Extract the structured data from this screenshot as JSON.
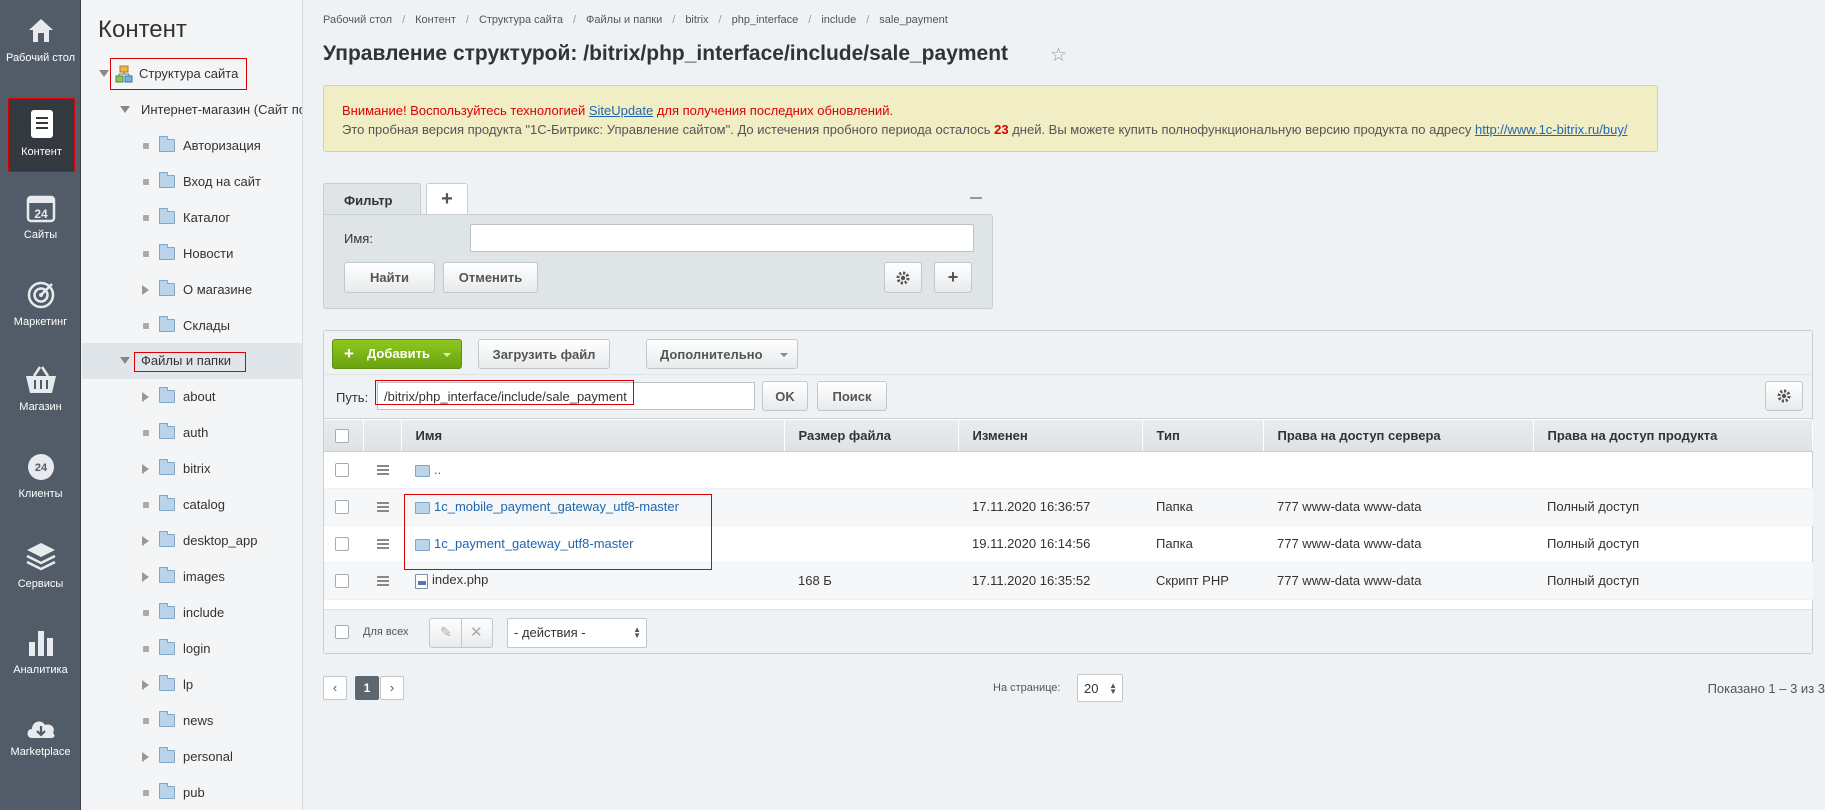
{
  "nav": [
    {
      "label": "Рабочий стол",
      "icon": "home-icon"
    },
    {
      "label": "Контент",
      "icon": "document-icon"
    },
    {
      "label": "Сайты",
      "icon": "calendar-24-icon"
    },
    {
      "label": "Маркетинг",
      "icon": "target-icon"
    },
    {
      "label": "Магазин",
      "icon": "basket-icon"
    },
    {
      "label": "Клиенты",
      "icon": "clients-24-icon"
    },
    {
      "label": "Сервисы",
      "icon": "layers-icon"
    },
    {
      "label": "Аналитика",
      "icon": "bar-chart-icon"
    },
    {
      "label": "Marketplace",
      "icon": "cloud-download-icon"
    }
  ],
  "tree": {
    "title": "Контент",
    "root": "Структура сайта",
    "shop": "Интернет-магазин (Сайт по",
    "shop_items": [
      {
        "label": "Авторизация",
        "expandable": false
      },
      {
        "label": "Вход на сайт",
        "expandable": false
      },
      {
        "label": "Каталог",
        "expandable": false
      },
      {
        "label": "Новости",
        "expandable": false
      },
      {
        "label": "О магазине",
        "expandable": true
      },
      {
        "label": "Склады",
        "expandable": false
      }
    ],
    "files": "Файлы и папки",
    "file_items": [
      {
        "label": "about",
        "expandable": true
      },
      {
        "label": "auth",
        "expandable": false
      },
      {
        "label": "bitrix",
        "expandable": true
      },
      {
        "label": "catalog",
        "expandable": false
      },
      {
        "label": "desktop_app",
        "expandable": true
      },
      {
        "label": "images",
        "expandable": true
      },
      {
        "label": "include",
        "expandable": false
      },
      {
        "label": "login",
        "expandable": false
      },
      {
        "label": "lp",
        "expandable": true
      },
      {
        "label": "news",
        "expandable": false
      },
      {
        "label": "personal",
        "expandable": true
      },
      {
        "label": "pub",
        "expandable": false
      }
    ]
  },
  "breadcrumb": [
    "Рабочий стол",
    "Контент",
    "Структура сайта",
    "Файлы и папки",
    "bitrix",
    "php_interface",
    "include",
    "sale_payment"
  ],
  "page_title": "Управление структурой: /bitrix/php_interface/include/sale_payment",
  "notice": {
    "line1_a": "Внимание! Воспользуйтесь технологией ",
    "line1_link": "SiteUpdate",
    "line1_b": " для получения последних обновлений.",
    "line2_a": "Это пробная версия продукта \"1С-Битрикс: Управление сайтом\". До истечения пробного периода осталось ",
    "days": "23",
    "line2_b": " дней. Вы можете купить полнофункциональную версию продукта по адресу ",
    "line2_link": "http://www.1c-bitrix.ru/buy/"
  },
  "filter": {
    "tab": "Фильтр",
    "add_tab": "+",
    "name_label": "Имя:",
    "name_value": "",
    "find": "Найти",
    "cancel": "Отменить"
  },
  "toolbar": {
    "add": "Добавить",
    "upload": "Загрузить файл",
    "more": "Дополнительно"
  },
  "path": {
    "label": "Путь:",
    "value": "/bitrix/php_interface/include/sale_payment",
    "ok": "OK",
    "search": "Поиск"
  },
  "table": {
    "columns": [
      "Имя",
      "Размер файла",
      "Изменен",
      "Тип",
      "Права на доступ сервера",
      "Права на доступ продукта"
    ],
    "rows": [
      {
        "name": "..",
        "kind": "up",
        "size": "",
        "modified": "",
        "type": "",
        "server": "",
        "product": ""
      },
      {
        "name": "1c_mobile_payment_gateway_utf8-master",
        "kind": "folder",
        "size": "",
        "modified": "17.11.2020 16:36:57",
        "type": "Папка",
        "server": "777 www-data www-data",
        "product": "Полный доступ"
      },
      {
        "name": "1c_payment_gateway_utf8-master",
        "kind": "folder",
        "size": "",
        "modified": "19.11.2020 16:14:56",
        "type": "Папка",
        "server": "777 www-data www-data",
        "product": "Полный доступ"
      },
      {
        "name": "index.php",
        "kind": "php",
        "size": "168 Б",
        "modified": "17.11.2020 16:35:52",
        "type": "Скрипт PHP",
        "server": "777 www-data www-data",
        "product": "Полный доступ"
      }
    ]
  },
  "footer": {
    "for_all": "Для всех",
    "actions": "- действия -"
  },
  "pager": {
    "prev": "‹",
    "current": "1",
    "next": "›",
    "per_page_label": "На странице:",
    "per_page": "20",
    "shown": "Показано 1 – 3 из 3"
  },
  "colors": {
    "nav_bg": "#525c69",
    "accent_green": "#7ab317",
    "link": "#2067b0",
    "warning": "#d00000"
  }
}
